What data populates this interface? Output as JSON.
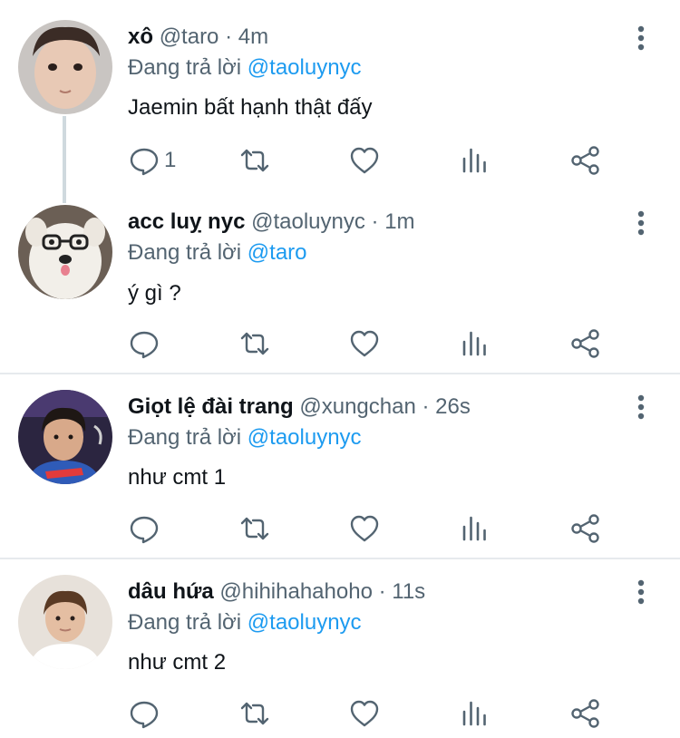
{
  "tweets": [
    {
      "name": "xô",
      "handle": "@taro",
      "time": "· 4m",
      "reply_prefix": "Đang trả lời",
      "reply_to": "@taoluynyc",
      "text": " Jaemin bất hạnh thật đấy",
      "reply_count": "1"
    },
    {
      "name": "acc luỵ nyc",
      "handle": "@taoluynyc",
      "time": "· 1m",
      "reply_prefix": "Đang trả lời",
      "reply_to": "@taro",
      "text": "ý gì ?",
      "reply_count": ""
    },
    {
      "name": "Giọt lệ đài trang",
      "handle": "@xungchan",
      "time": "· 26s",
      "reply_prefix": "Đang trả lời",
      "reply_to": "@taoluynyc",
      "text": "như cmt 1",
      "reply_count": ""
    },
    {
      "name": "dâu hứa",
      "handle": "@hihihahahoho",
      "time": "· 11s",
      "reply_prefix": "Đang trả lời",
      "reply_to": "@taoluynyc",
      "text": "như cmt 2",
      "reply_count": ""
    }
  ],
  "icons": {
    "reply": "comment-icon",
    "retweet": "retweet-icon",
    "like": "heart-icon",
    "views": "analytics-icon",
    "share": "share-icon",
    "more": "more-vertical-icon"
  },
  "colors": {
    "mention": "#1d9bf0",
    "muted": "#536471",
    "text": "#0f1419",
    "divider": "#e6eaed"
  }
}
